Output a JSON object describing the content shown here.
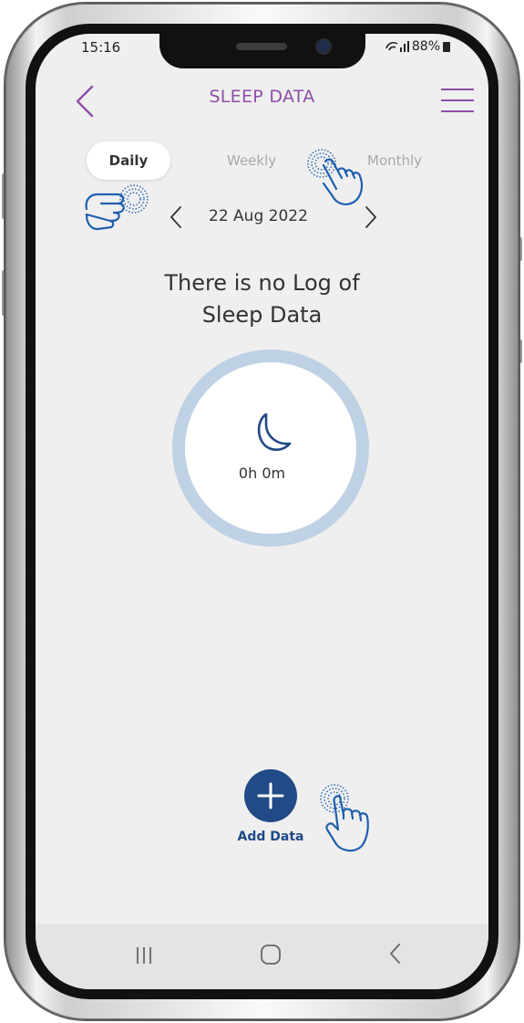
{
  "status_bar": {
    "time": "15:16",
    "battery": "88%"
  },
  "header": {
    "title": "SLEEP DATA"
  },
  "tabs": [
    {
      "label": "Daily",
      "active": true
    },
    {
      "label": "Weekly",
      "active": false
    },
    {
      "label": "Monthly",
      "active": false
    }
  ],
  "date_nav": {
    "date": "22 Aug 2022"
  },
  "empty_state": {
    "line1": "There is no Log of",
    "line2": "Sleep Data"
  },
  "sleep_summary": {
    "duration": "0h 0m"
  },
  "add_data": {
    "label": "Add Data"
  },
  "colors": {
    "title": "#8e4ea8",
    "ring": "#bfd1e4",
    "primary": "#214a86",
    "hand": "#1d5fae"
  },
  "icons": [
    "back-arrow-icon",
    "hamburger-menu-icon",
    "chevron-left-icon",
    "chevron-right-icon",
    "moon-icon",
    "plus-icon",
    "tap-hand-icon",
    "nav-recents-icon",
    "nav-home-icon",
    "nav-back-icon"
  ]
}
